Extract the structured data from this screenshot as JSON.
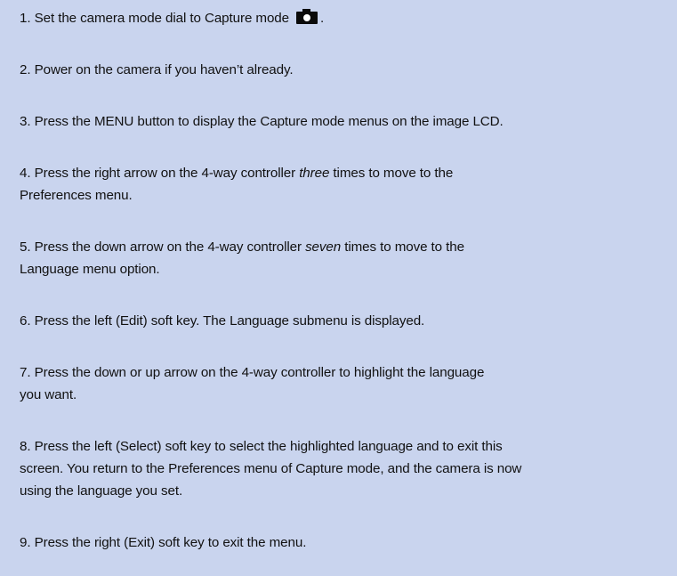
{
  "steps": [
    {
      "num": "1.",
      "text": "Set the camera mode dial to Capture mode",
      "after_icon": "."
    },
    {
      "num": "2.",
      "text": "Power on the camera if you haven’t already."
    },
    {
      "num": "3.",
      "text": "Press the MENU button to display the Capture mode menus on the image LCD."
    },
    {
      "num": "4.",
      "pre": "Press the right arrow on the 4-way controller ",
      "em": "three",
      "post": " times to move to the",
      "line2": "Preferences menu."
    },
    {
      "num": "5.",
      "pre": "Press the down arrow on the 4-way controller ",
      "em": "seven",
      "post": " times to move to the",
      "line2": "Language menu option."
    },
    {
      "num": "6.",
      "text": "Press the left (Edit) soft key. The Language submenu is displayed."
    },
    {
      "num": "7.",
      "text": "Press the down or up arrow on the 4-way controller to highlight the language",
      "line2": "you want."
    },
    {
      "num": "8.",
      "text": "Press the left (Select) soft key to select the highlighted language and to exit this",
      "line2": "screen. You return to the Preferences menu of Capture mode, and the camera is now",
      "line3": "using the language you set."
    },
    {
      "num": "9.",
      "text": "Press the right (Exit) soft key to exit the menu."
    }
  ],
  "icons": {
    "capture_mode": "camera-icon"
  },
  "colors": {
    "panel_background": "#c9d4ee",
    "text": "#111111"
  }
}
